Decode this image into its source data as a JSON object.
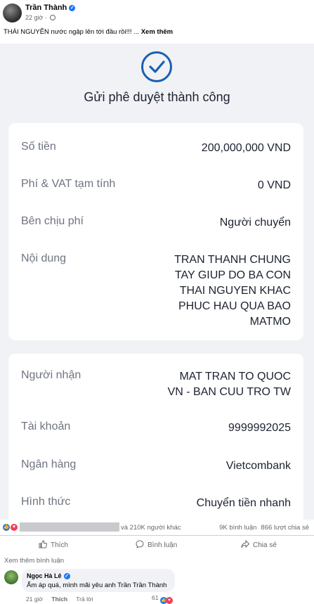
{
  "post": {
    "author": "Trần Thành",
    "time": "22 giờ ·",
    "caption": "THÁI NGUYÊN nước ngập lên tới đầu rồi!!! ...",
    "see_more": "Xem thêm"
  },
  "receipt": {
    "title": "Gửi phê duyệt thành công",
    "card1": [
      {
        "label": "Số tiền",
        "value": "200,000,000 VND"
      },
      {
        "label": "Phí & VAT tạm tính",
        "value": "0 VND"
      },
      {
        "label": "Bên chịu phí",
        "value": "Người chuyển"
      },
      {
        "label": "Nội dung",
        "value_lines": [
          "TRAN THANH CHUNG",
          "TAY GIUP DO BA CON",
          "THAI NGUYEN KHAC",
          "PHUC HAU QUA BAO",
          "MATMO"
        ]
      }
    ],
    "card2": [
      {
        "label": "Người nhận",
        "value_lines": [
          "MAT TRAN TO QUOC",
          "VN - BAN CUU TRO TW"
        ]
      },
      {
        "label": "Tài khoản",
        "value": "9999992025"
      },
      {
        "label": "Ngân hàng",
        "value": "Vietcombank"
      },
      {
        "label": "Hình thức",
        "value": "Chuyển tiền nhanh"
      }
    ]
  },
  "stats": {
    "reactions_text": "và 210K người khác",
    "comments": "9K bình luận",
    "shares": "866 lượt chia sẻ"
  },
  "actions": {
    "like": "Thích",
    "comment": "Bình luận",
    "share": "Chia sẻ"
  },
  "comments_section": {
    "see_more": "Xem thêm bình luận",
    "comment": {
      "author": "Ngọc Hà Lê",
      "text": "Ấm áp quá, mình mãi yêu anh Trần Trần Thành",
      "time": "21 giờ",
      "like": "Thích",
      "reply": "Trả lời",
      "reaction_count": "61"
    }
  },
  "colors": {
    "brand": "#1877f2",
    "receipt_blue": "#1a5fb4",
    "love": "#f33e58"
  }
}
